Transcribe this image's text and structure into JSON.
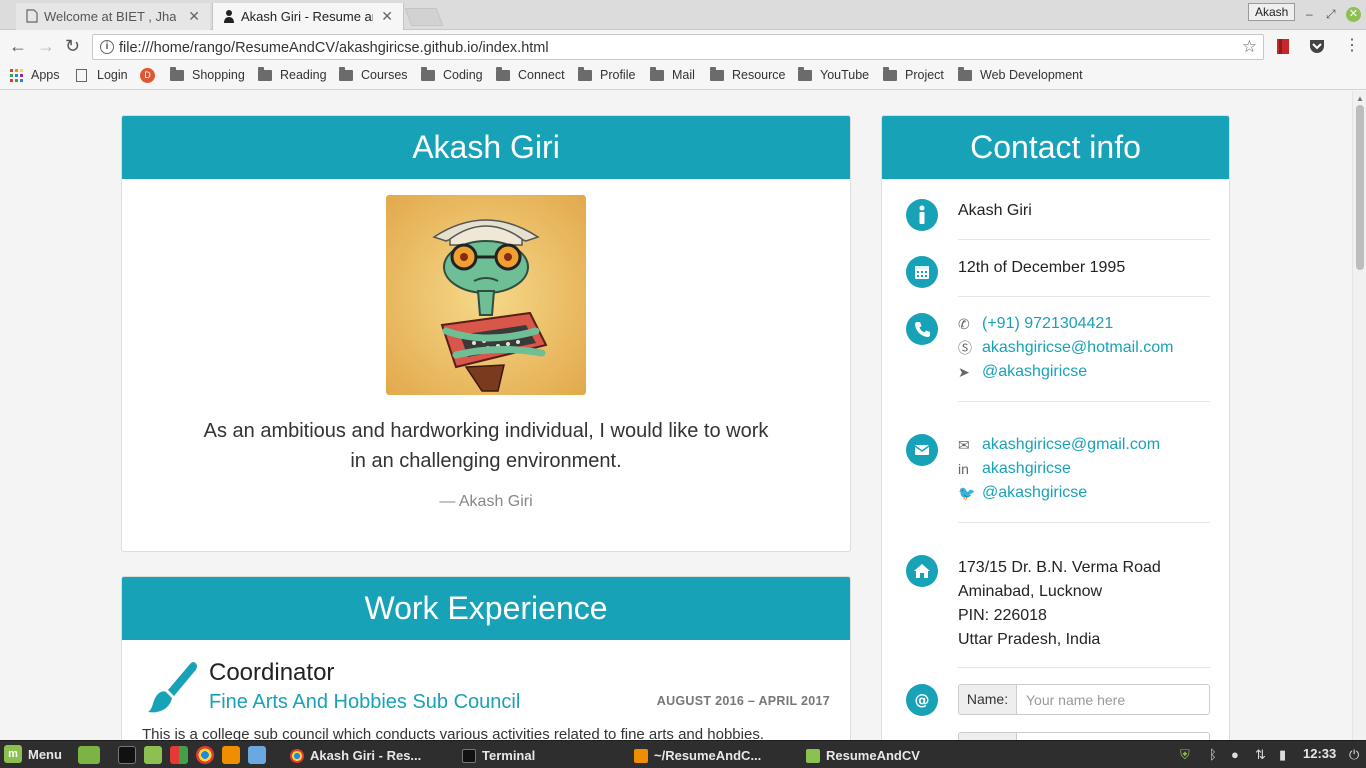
{
  "browser": {
    "tabs": [
      {
        "title": "Welcome at BIET , Jhans",
        "state": "inactive"
      },
      {
        "title": "Akash Giri - Resume and",
        "state": "active"
      }
    ],
    "profile_name": "Akash",
    "url": "file:///home/rango/ResumeAndCV/akashgiricse.github.io/index.html",
    "bookmarks": [
      "Apps",
      "Login",
      "",
      "Shopping",
      "Reading",
      "Courses",
      "Coding",
      "Connect",
      "Profile",
      "Mail",
      "Resource",
      "YouTube",
      "Project",
      "Web Development"
    ]
  },
  "profile": {
    "name": "Akash Giri",
    "quote": "As an ambitious and hardworking individual, I would like to work in an challenging environment.",
    "quote_author": "— Akash Giri"
  },
  "work": {
    "heading": "Work Experience",
    "title": "Coordinator",
    "organization": "Fine Arts And Hobbies Sub Council",
    "dates": "AUGUST 2016 – APRIL 2017",
    "description": "This is a college sub council which conducts various activities related to fine arts and hobbies."
  },
  "contact": {
    "heading": "Contact info",
    "name": "Akash Giri",
    "dob": "12th of December 1995",
    "phone": "(+91) 9721304421",
    "skype": "akashgiricse@hotmail.com",
    "telegram": "@akashgiricse",
    "email": "akashgiricse@gmail.com",
    "linkedin": "akashgiricse",
    "twitter": "@akashgiricse",
    "address": [
      "173/15 Dr. B.N. Verma Road",
      "Aminabad, Lucknow",
      "PIN: 226018",
      "Uttar Pradesh, India"
    ],
    "form": {
      "name_label": "Name:",
      "name_placeholder": "Your name here"
    }
  },
  "taskbar": {
    "menu_label": "Menu",
    "tasks": [
      "Akash Giri - Res...",
      "Terminal",
      "~/ResumeAndC...",
      "ResumeAndCV"
    ],
    "clock": "12:33"
  },
  "colors": {
    "accent": "#18a2b8",
    "mint_green": "#8cc152",
    "taskbar": "#2e2e2e"
  }
}
